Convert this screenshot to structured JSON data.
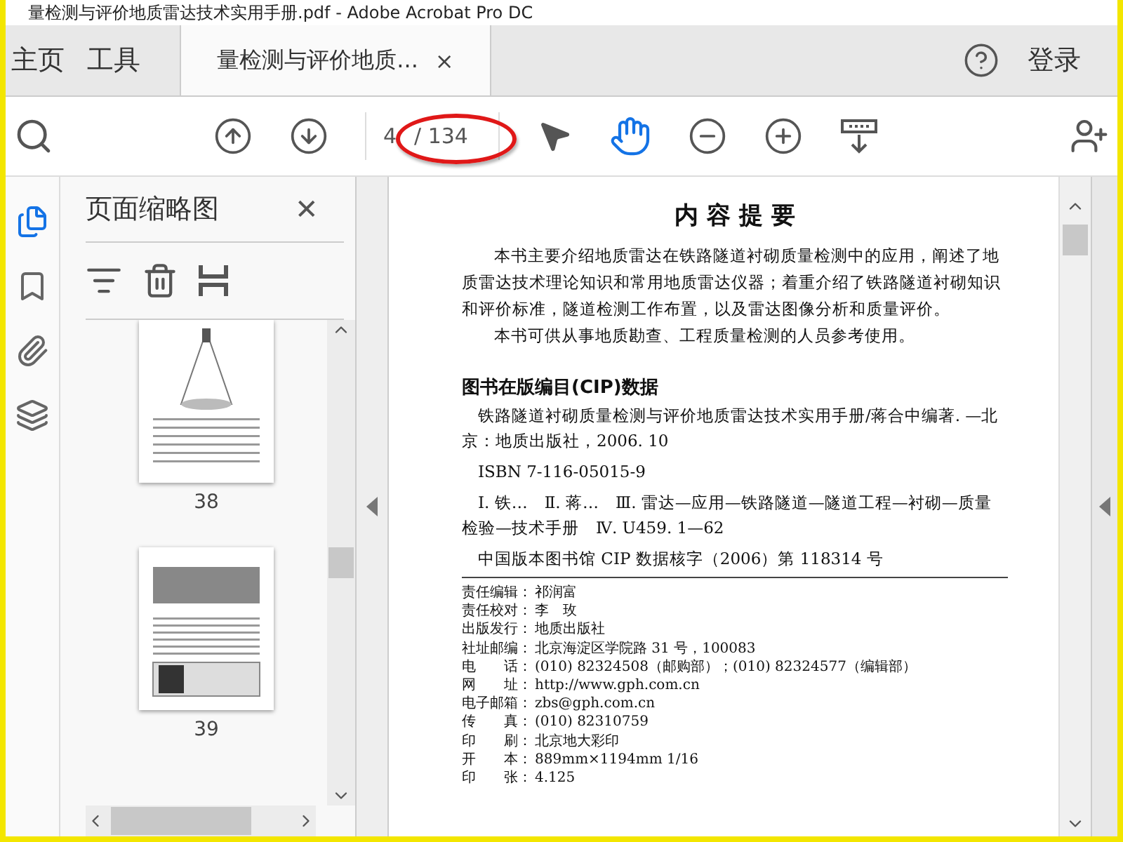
{
  "window": {
    "title": "量检测与评价地质雷达技术实用手册.pdf - Adobe Acrobat Pro DC"
  },
  "tabs": [
    {
      "label": "主页",
      "selected": false,
      "kind": "nav"
    },
    {
      "label": "工具",
      "selected": false,
      "kind": "nav"
    },
    {
      "label": "量检测与评价地质...",
      "selected": true,
      "kind": "document",
      "close": "×"
    }
  ],
  "account": {
    "signin": "登录"
  },
  "toolbar": {
    "page_value": "4",
    "page_total": "/ 134",
    "tools": [
      {
        "kind": "pointer",
        "selected": false
      },
      {
        "kind": "hand",
        "selected": true
      }
    ]
  },
  "rail": [
    {
      "kind": "pages",
      "selected": true
    },
    {
      "kind": "bookmark",
      "selected": false
    },
    {
      "kind": "attachment",
      "selected": false
    },
    {
      "kind": "layers",
      "selected": false
    }
  ],
  "sidebar": {
    "title": "页面缩略图",
    "close": "✕",
    "thumbnails": [
      {
        "page": "38",
        "kind": "diagram",
        "selected": false
      },
      {
        "page": "39",
        "kind": "charts",
        "selected": false
      }
    ]
  },
  "document": {
    "heading": "内 容 提 要",
    "summary": [
      "本书主要介绍地质雷达在铁路隧道衬砌质量检测中的应用，阐述了地质雷达技术理论知识和常用地质雷达仪器；着重介绍了铁路隧道衬砌知识和评价标准，隧道检测工作布置，以及雷达图像分析和质量评价。",
      "本书可供从事地质勘查、工程质量检测的人员参考使用。"
    ],
    "cip_heading": "图书在版编目(CIP)数据",
    "cip_lines": [
      "铁路隧道衬砌质量检测与评价地质雷达技术实用手册/蒋合中编著. —北京：地质出版社，2006. 10",
      "ISBN 7-116-05015-9",
      "Ⅰ. 铁…　Ⅱ. 蒋…　Ⅲ. 雷达—应用—铁路隧道—隧道工程—衬砌—质量检验—技术手册　Ⅳ. U459. 1—62",
      "中国版本图书馆 CIP 数据核字（2006）第 118314 号"
    ],
    "imprint": [
      {
        "label": "责任编辑：",
        "value": "祁润富"
      },
      {
        "label": "责任校对：",
        "value": "李　玫"
      },
      {
        "label": "出版发行：",
        "value": "地质出版社"
      },
      {
        "label": "社址邮编：",
        "value": "北京海淀区学院路 31 号，100083"
      },
      {
        "label": "电　　话：",
        "value": "(010) 82324508（邮购部）；(010) 82324577（编辑部）"
      },
      {
        "label": "网　　址：",
        "value": "http://www.gph.com.cn"
      },
      {
        "label": "电子邮箱：",
        "value": "zbs@gph.com.cn"
      },
      {
        "label": "传　　真：",
        "value": "(010) 82310759"
      },
      {
        "label": "印　　刷：",
        "value": "北京地大彩印"
      },
      {
        "label": "开　　本：",
        "value": "889mm×1194mm 1/16"
      },
      {
        "label": "印　　张：",
        "value": "4.125"
      }
    ]
  }
}
